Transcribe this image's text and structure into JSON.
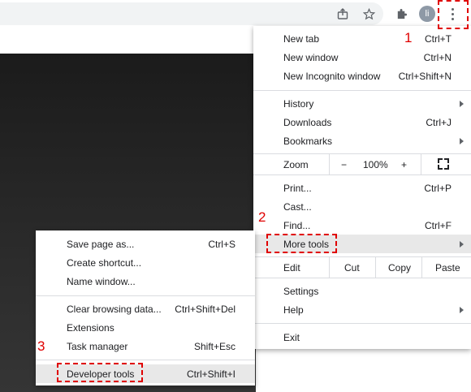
{
  "profile": {
    "initial": "li"
  },
  "menu": {
    "new_tab": {
      "label": "New tab",
      "shortcut": "Ctrl+T"
    },
    "new_window": {
      "label": "New window",
      "shortcut": "Ctrl+N"
    },
    "new_incognito": {
      "label": "New Incognito window",
      "shortcut": "Ctrl+Shift+N"
    },
    "history": {
      "label": "History"
    },
    "downloads": {
      "label": "Downloads",
      "shortcut": "Ctrl+J"
    },
    "bookmarks": {
      "label": "Bookmarks"
    },
    "zoom": {
      "label": "Zoom",
      "minus": "−",
      "value": "100%",
      "plus": "+"
    },
    "print": {
      "label": "Print...",
      "shortcut": "Ctrl+P"
    },
    "cast": {
      "label": "Cast..."
    },
    "find": {
      "label": "Find...",
      "shortcut": "Ctrl+F"
    },
    "more_tools": {
      "label": "More tools"
    },
    "edit": {
      "label": "Edit",
      "cut": "Cut",
      "copy": "Copy",
      "paste": "Paste"
    },
    "settings": {
      "label": "Settings"
    },
    "help": {
      "label": "Help"
    },
    "exit": {
      "label": "Exit"
    }
  },
  "submenu": {
    "save_page": {
      "label": "Save page as...",
      "shortcut": "Ctrl+S"
    },
    "create_shortcut": {
      "label": "Create shortcut..."
    },
    "name_window": {
      "label": "Name window..."
    },
    "clear_data": {
      "label": "Clear browsing data...",
      "shortcut": "Ctrl+Shift+Del"
    },
    "extensions": {
      "label": "Extensions"
    },
    "task_manager": {
      "label": "Task manager",
      "shortcut": "Shift+Esc"
    },
    "developer_tools": {
      "label": "Developer tools",
      "shortcut": "Ctrl+Shift+I"
    }
  },
  "annotations": {
    "step1": "1",
    "step2": "2",
    "step3": "3"
  },
  "icons": [
    "share-icon",
    "star-icon",
    "extensions-puzzle-icon",
    "more-vert-icon",
    "fullscreen-icon",
    "chevron-right-icon"
  ],
  "colors": {
    "annotation": "#e00000",
    "highlight": "#e8e8e8"
  }
}
